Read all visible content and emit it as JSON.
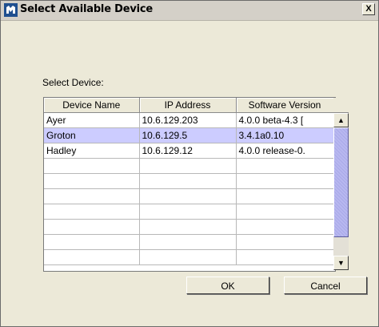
{
  "window": {
    "title": "Select Available Device",
    "close_label": "X"
  },
  "dialog": {
    "select_label": "Select Device:",
    "columns": [
      "Device Name",
      "IP Address",
      "Software Version"
    ],
    "rows": [
      [
        "Ayer",
        "10.6.129.203",
        "4.0.0 beta-4.3 ["
      ],
      [
        "Groton",
        "10.6.129.5",
        "3.4.1a0.10"
      ],
      [
        "Hadley",
        "10.6.129.12",
        "4.0.0 release-0."
      ],
      [
        "",
        "",
        ""
      ],
      [
        "",
        "",
        ""
      ],
      [
        "",
        "",
        ""
      ],
      [
        "",
        "",
        ""
      ],
      [
        "",
        "",
        ""
      ],
      [
        "",
        "",
        ""
      ],
      [
        "",
        "",
        ""
      ]
    ],
    "selected_row": 1,
    "scroll_up": "▲",
    "scroll_down": "▼",
    "ok_label": "OK",
    "cancel_label": "Cancel"
  },
  "colors": {
    "selection": "#ccccff",
    "scroll_thumb": "#b8b8f0",
    "dialog_bg": "#ece9d8"
  }
}
